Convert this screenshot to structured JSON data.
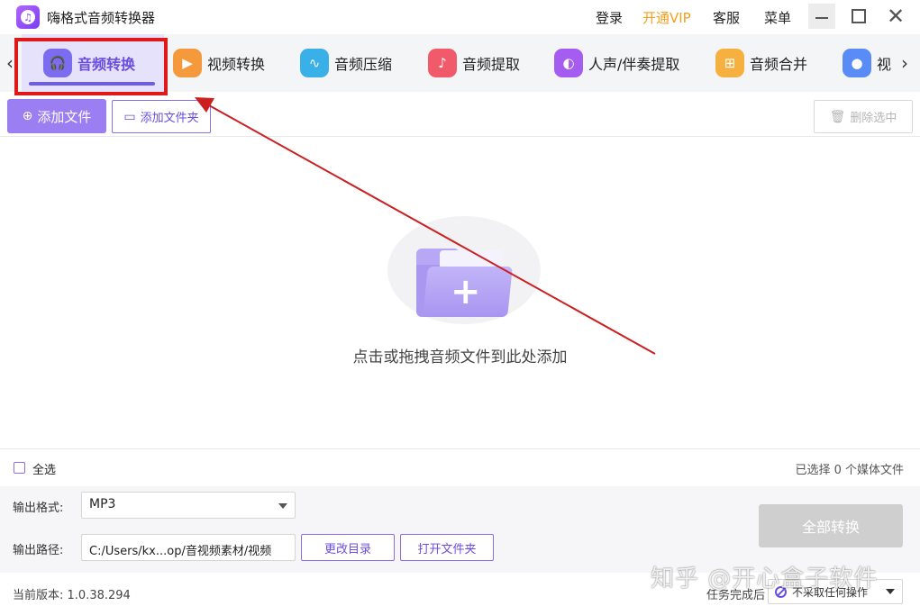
{
  "app": {
    "title": "嗨格式音频转换器",
    "logo_glyph": "♫"
  },
  "titlebar": {
    "login": "登录",
    "vip": "开通VIP",
    "support": "客服",
    "menu": "菜单",
    "vip_color": "#f0a020"
  },
  "tabs": [
    {
      "label": "音频转换",
      "icon": "headphones-icon",
      "glyph": "🎧",
      "color": "#7b6cf0",
      "active": true
    },
    {
      "label": "视频转换",
      "icon": "video-camera-icon",
      "glyph": "▶",
      "color": "#f59a3c",
      "active": false
    },
    {
      "label": "音频压缩",
      "icon": "waveform-icon",
      "glyph": "∿",
      "color": "#3ab0e8",
      "active": false
    },
    {
      "label": "音频提取",
      "icon": "microphone-icon",
      "glyph": "♪",
      "color": "#f05a6a",
      "active": false
    },
    {
      "label": "人声/伴奏提取",
      "icon": "voice-split-icon",
      "glyph": "◐",
      "color": "#a55cf0",
      "active": false
    },
    {
      "label": "音频合并",
      "icon": "merge-icon",
      "glyph": "⊞",
      "color": "#f5b040",
      "active": false
    },
    {
      "label": "视",
      "icon": "video-droplet-icon",
      "glyph": "●",
      "color": "#5a8cf5",
      "active": false
    }
  ],
  "toolbar": {
    "add_file": "添加文件",
    "add_folder": "添加文件夹",
    "delete_selected": "删除选中"
  },
  "drop_area": {
    "hint": "点击或拖拽音频文件到此处添加"
  },
  "selection": {
    "select_all": "全选",
    "selected_count": "已选择 0 个媒体文件"
  },
  "output": {
    "format_label": "输出格式:",
    "format_value": "MP3",
    "path_label": "输出路径:",
    "path_value": "C:/Users/kx...op/音视频素材/视频",
    "change_dir": "更改目录",
    "open_folder": "打开文件夹",
    "convert_all": "全部转换"
  },
  "status": {
    "version": "当前版本: 1.0.38.294",
    "after_task_label": "任务完成后",
    "after_task_value": "不采取任何操作"
  },
  "watermark": "知乎 @开心盒子软件",
  "colors": {
    "accent": "#6a4ee0",
    "highlight_box": "#e01818",
    "annotation_arrow": "#cc1f1f"
  }
}
